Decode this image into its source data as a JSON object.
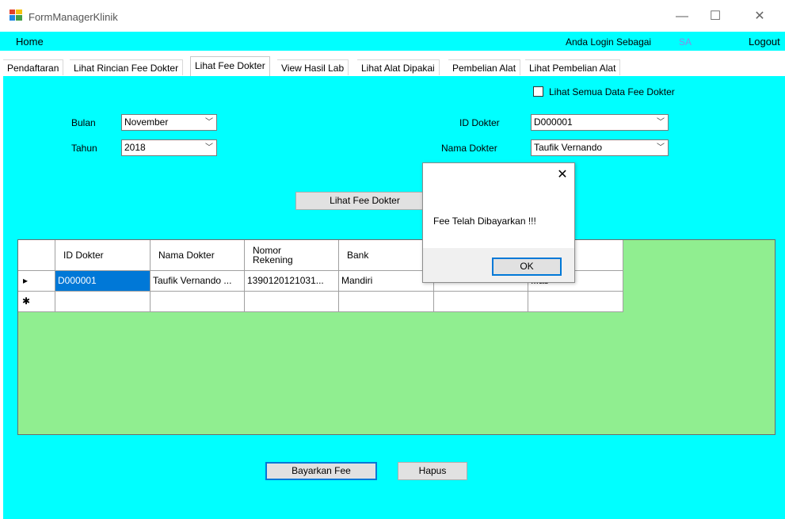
{
  "window": {
    "title": "FormManagerKlinik",
    "controls": {
      "minimize": "—",
      "maximize": "☐",
      "close": "✕"
    }
  },
  "menu": {
    "home": "Home",
    "login_label": "Anda Login Sebagai",
    "login_user": "SA",
    "logout": "Logout"
  },
  "tabs": [
    {
      "label": "Pendaftaran"
    },
    {
      "label": "Lihat Rincian Fee Dokter"
    },
    {
      "label": "Lihat Fee Dokter"
    },
    {
      "label": "View Hasil Lab"
    },
    {
      "label": "Lihat Alat Dipakai"
    },
    {
      "label": "Pembelian Alat"
    },
    {
      "label": "Lihat Pembelian Alat"
    }
  ],
  "form": {
    "checkbox_label": "Lihat Semua Data Fee Dokter",
    "bulan_label": "Bulan",
    "bulan_value": "November",
    "tahun_label": "Tahun",
    "tahun_value": "2018",
    "id_dokter_label": "ID Dokter",
    "id_dokter_value": "D000001",
    "nama_dokter_label": "Nama Dokter",
    "nama_dokter_value": "Taufik Vernando",
    "lihat_button": "Lihat Fee Dokter"
  },
  "grid": {
    "columns": [
      "ID Dokter",
      "Nama Dokter",
      "Nomor\nRekening",
      "Bank",
      "",
      "...an"
    ],
    "rows": [
      [
        "D000001",
        "Taufik Vernando ...",
        "1390120121031...",
        "Mandiri",
        "",
        "...as"
      ]
    ],
    "row_marker": "▸",
    "new_row_marker": "✱"
  },
  "buttons": {
    "bayarkan": "Bayarkan Fee",
    "hapus": "Hapus"
  },
  "dialog": {
    "message": "Fee Telah Dibayarkan !!!",
    "ok": "OK",
    "close": "✕"
  },
  "colors": {
    "panel": "#00ffff",
    "grid_background": "#90ee90",
    "selection": "#0078d7"
  }
}
